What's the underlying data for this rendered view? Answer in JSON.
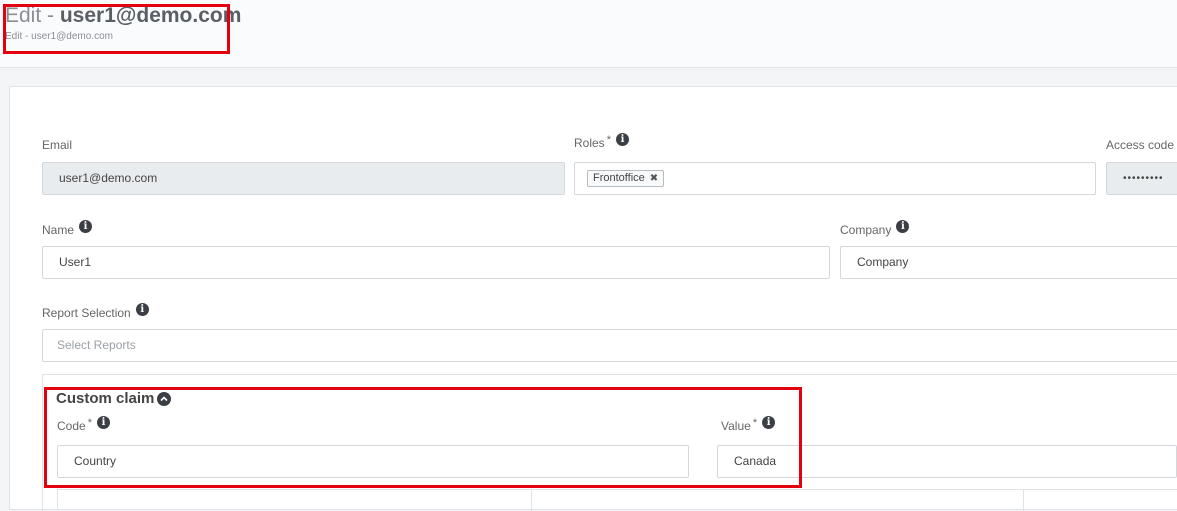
{
  "header": {
    "title_prefix": "Edit - ",
    "title_user": "user1@demo.com",
    "subtitle": "Edit - user1@demo.com"
  },
  "form": {
    "email": {
      "label": "Email",
      "value": "user1@demo.com"
    },
    "roles": {
      "label": "Roles",
      "required": "*",
      "tags": [
        "Frontoffice"
      ],
      "remove_glyph": "✖"
    },
    "access_code": {
      "label": "Access code",
      "value": "•••••••••"
    },
    "name": {
      "label": "Name",
      "value": "User1"
    },
    "company": {
      "label": "Company",
      "value": "Company"
    },
    "report_selection": {
      "label": "Report Selection",
      "placeholder": "Select Reports"
    }
  },
  "custom_claim": {
    "title": "Custom claim",
    "code": {
      "label": "Code",
      "required": "*",
      "value": "Country"
    },
    "value": {
      "label": "Value",
      "required": "*",
      "value": "Canada"
    }
  },
  "icons": {
    "info": "info-icon",
    "collapse": "chevron-up-icon"
  },
  "colors": {
    "highlight": "#e3000f",
    "disabled_input": "#e9ecef"
  }
}
